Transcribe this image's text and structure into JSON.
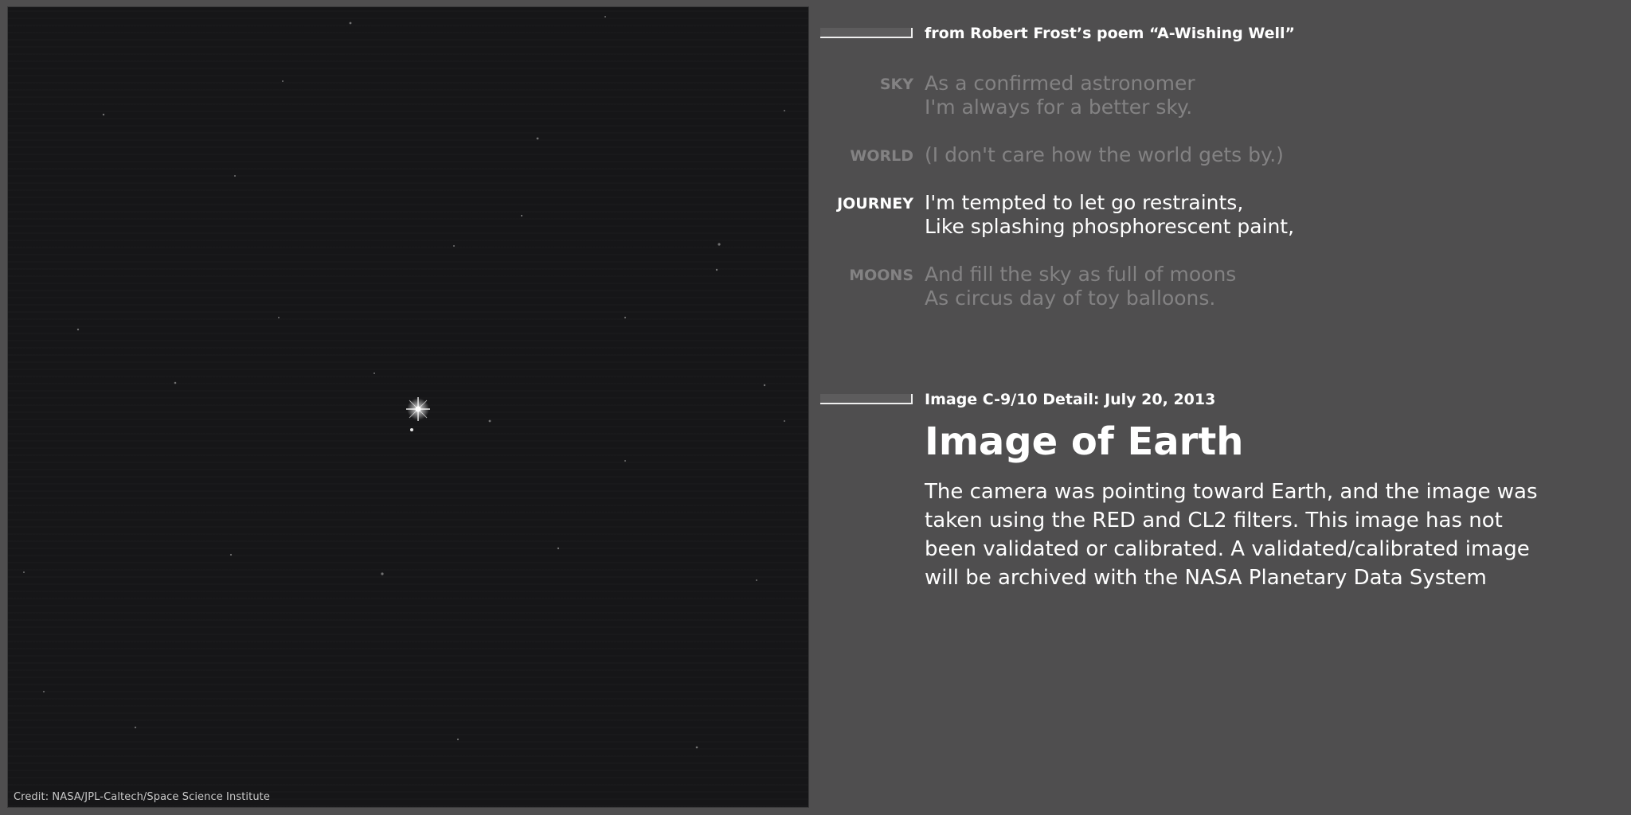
{
  "photo": {
    "credit": "Credit: NASA/JPL-Caltech/Space Science Institute"
  },
  "poem": {
    "kicker": "from Robert Frost’s poem “A-Wishing Well”",
    "stanzas": [
      {
        "label": "SKY",
        "lines": [
          "As a confirmed astronomer",
          "I'm always for a better sky."
        ],
        "active": false
      },
      {
        "label": "WORLD",
        "lines": [
          "(I don't care how the world gets by.)"
        ],
        "active": false
      },
      {
        "label": "JOURNEY",
        "lines": [
          "I'm tempted to let go restraints,",
          "Like splashing phosphorescent paint,"
        ],
        "active": true
      },
      {
        "label": "MOONS",
        "lines": [
          "And fill the sky as full of moons",
          "As circus day of toy balloons."
        ],
        "active": false
      }
    ]
  },
  "detail": {
    "kicker": "Image C-9/10 Detail: July 20, 2013",
    "title": "Image of Earth",
    "body": "The camera was pointing toward Earth, and the image was taken using the RED and CL2 filters. This image has not been validated or calibrated. A validated/calibrated image will be archived with the NASA Planetary Data System"
  },
  "colors": {
    "background": "#4f4e4f",
    "photo_bg": "#161618",
    "active_text": "#ffffff",
    "dim_text": "#838283"
  }
}
